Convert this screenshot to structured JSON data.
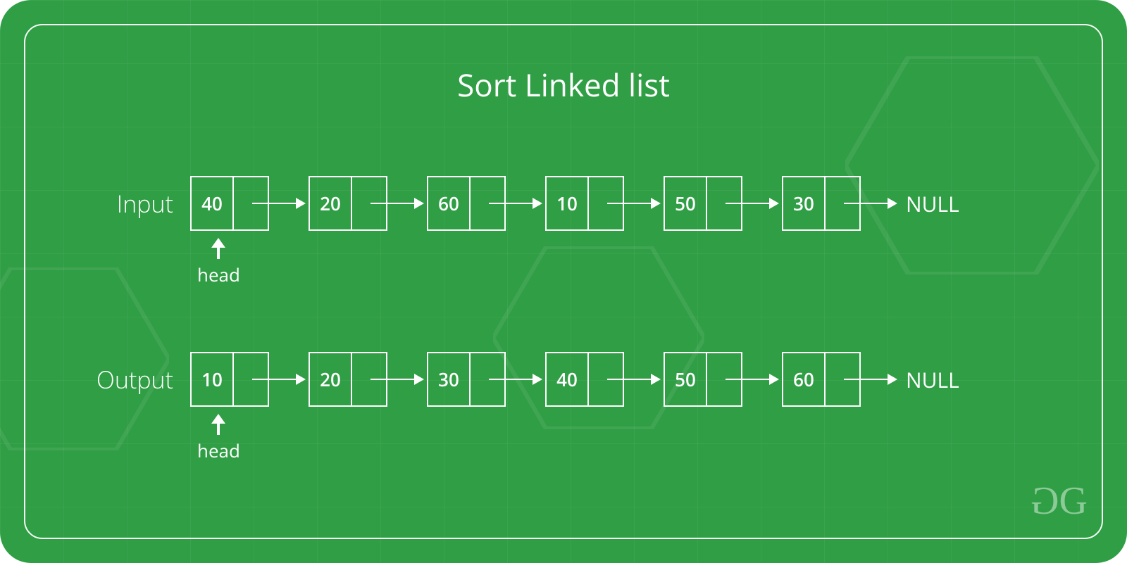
{
  "title": "Sort Linked list",
  "labels": {
    "input": "Input",
    "output": "Output",
    "null": "NULL",
    "head": "head"
  },
  "input_list": [
    "40",
    "20",
    "60",
    "10",
    "50",
    "30"
  ],
  "output_list": [
    "10",
    "20",
    "30",
    "40",
    "50",
    "60"
  ],
  "logo": "GG"
}
